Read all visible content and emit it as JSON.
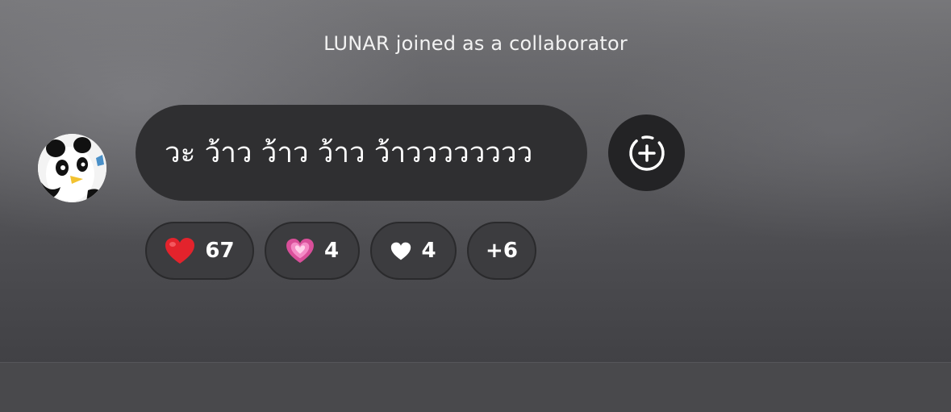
{
  "system_message": "LUNAR joined as a collaborator",
  "message": {
    "text": "วะ ว้าว ว้าว ว้าว ว้าวววววววว",
    "avatar_icon": "panda-avatar"
  },
  "add_reaction_icon": "add-reaction-icon",
  "reactions": [
    {
      "emoji": "red-heart",
      "count": "67",
      "color": "#e0202a"
    },
    {
      "emoji": "pink-heart",
      "count": "4",
      "color": "#e46bb0"
    },
    {
      "emoji": "white-heart",
      "count": "4",
      "color": "#ffffff"
    },
    {
      "emoji": "",
      "count": "+6"
    }
  ]
}
